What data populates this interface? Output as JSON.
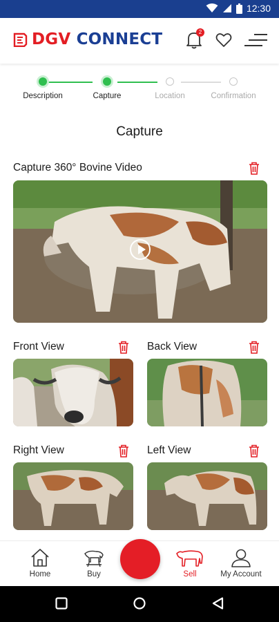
{
  "status_bar": {
    "time": "12:30"
  },
  "header": {
    "brand_part1": "DGV",
    "brand_part2": "CONNECT",
    "notification_count": "2"
  },
  "stepper": {
    "steps": [
      {
        "label": "Description",
        "state": "done"
      },
      {
        "label": "Capture",
        "state": "done"
      },
      {
        "label": "Location",
        "state": "todo"
      },
      {
        "label": "Confirmation",
        "state": "todo"
      }
    ]
  },
  "page": {
    "heading": "Capture"
  },
  "video": {
    "title": "Capture 360° Bovine  Video"
  },
  "views": [
    {
      "title": "Front View"
    },
    {
      "title": "Back View"
    },
    {
      "title": "Right View"
    },
    {
      "title": "Left View"
    }
  ],
  "bottom_nav": {
    "items": [
      {
        "label": "Home"
      },
      {
        "label": "Buy"
      },
      {
        "label": "Sell"
      },
      {
        "label": "My Account"
      }
    ],
    "active": "Sell"
  },
  "colors": {
    "brand_red": "#e31e24",
    "brand_blue": "#1b3f94",
    "status_bar": "#1a3f8f",
    "step_done": "#2fbf4f"
  }
}
